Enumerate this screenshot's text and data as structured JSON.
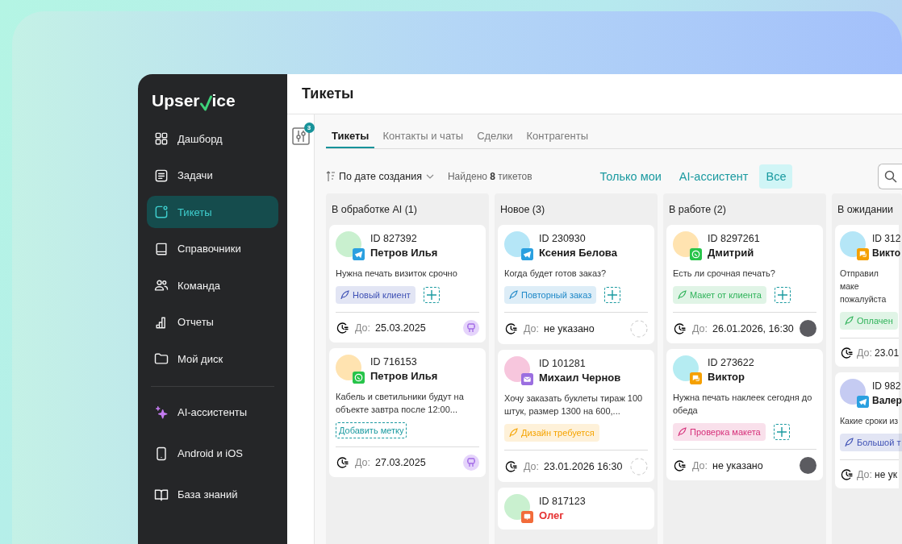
{
  "logo": {
    "before": "Upser",
    "after": "ice"
  },
  "sidebar": {
    "items": [
      {
        "kind": "dashboard",
        "label": "Дашборд",
        "selected": false
      },
      {
        "kind": "tasks",
        "label": "Задачи",
        "selected": false
      },
      {
        "kind": "tickets",
        "label": "Тикеты",
        "selected": true
      },
      {
        "kind": "book",
        "label": "Справочники",
        "selected": false
      },
      {
        "kind": "team",
        "label": "Команда",
        "selected": false
      },
      {
        "kind": "reports",
        "label": "Отчеты",
        "selected": false
      },
      {
        "kind": "folder",
        "label": "Мой диск",
        "selected": false
      }
    ],
    "extra_items": [
      {
        "kind": "sparkle",
        "label": "AI-ассистенты",
        "selected": false
      },
      {
        "kind": "phone",
        "label": "Android и iOS",
        "selected": false
      },
      {
        "kind": "open-book",
        "label": "База знаний",
        "selected": false
      }
    ]
  },
  "header": {
    "title": "Тикеты"
  },
  "filter_badge": "3",
  "tabs": [
    {
      "label": "Тикеты",
      "selected": true
    },
    {
      "label": "Контакты и чаты",
      "selected": false
    },
    {
      "label": "Сделки",
      "selected": false
    },
    {
      "label": "Контрагенты",
      "selected": false
    }
  ],
  "toolbar": {
    "sort": "По дате создания",
    "found": "Найдено **8** тикетов",
    "filters": [
      {
        "label": "Только мои",
        "selected": false
      },
      {
        "label": "AI-ассистент",
        "selected": false
      },
      {
        "label": "Все",
        "selected": true
      }
    ]
  },
  "columns": [
    {
      "title": "В обработке AI (1)",
      "cards": [
        {
          "id": "ID 827392",
          "name": "Петров Илья",
          "name_alert": false,
          "avatar": {
            "color": "#c9f0cf"
          },
          "channel": {
            "kind": "telegram"
          },
          "message": "Нужна печать визиток срочно",
          "tag": {
            "label": "Новый клиент",
            "color": "#3f51b5"
          },
          "add_button": {
            "kind": "icon"
          },
          "due_prefix": "До:",
          "due": "25.03.2025",
          "assignee": {
            "kind": "bot"
          }
        },
        {
          "id": "ID 716153",
          "name": "Петров Илья",
          "name_alert": false,
          "avatar": {
            "color": "#ffe3b0"
          },
          "channel": {
            "kind": "whatsapp"
          },
          "message": "Кабель и светильники будут на объекте завтра после 12:00...",
          "add_button": {
            "kind": "text",
            "label": "Добавить метку"
          },
          "due_prefix": "До:",
          "due": "27.03.2025",
          "assignee": {
            "kind": "bot"
          }
        }
      ]
    },
    {
      "title": "Новое (3)",
      "cards": [
        {
          "id": "ID 230930",
          "name": "Ксения Белова",
          "name_alert": false,
          "avatar": {
            "color": "#b5e6f7"
          },
          "channel": {
            "kind": "telegram"
          },
          "message": "Когда будет готов заказ?",
          "tag": {
            "label": "Повторный заказ",
            "color": "#1e88c8"
          },
          "add_button": {
            "kind": "icon"
          },
          "due_prefix": "До:",
          "due": "не указано",
          "assignee": {
            "kind": "empty"
          }
        },
        {
          "id": "ID 101281",
          "name": "Михаил Чернов",
          "name_alert": false,
          "avatar": {
            "color": "#f7c6dd"
          },
          "channel": {
            "kind": "email"
          },
          "message": "Хочу заказать буклеты тираж 100 штук, размер 1300 на 600,...",
          "tag": {
            "label": "Дизайн требуется",
            "color": "#f5a300"
          },
          "due_prefix": "До:",
          "due": "23.01.2026 16:30",
          "assignee": {
            "kind": "empty"
          }
        },
        {
          "id": "ID 817123",
          "name": "Олег",
          "name_alert": true,
          "avatar": {
            "color": "#c9f0cf"
          },
          "channel": {
            "kind": "chat-red"
          }
        }
      ]
    },
    {
      "title": "В работе (2)",
      "cards": [
        {
          "id": "ID 8297261",
          "name": "Дмитрий",
          "name_alert": false,
          "avatar": {
            "color": "#ffe3b0"
          },
          "channel": {
            "kind": "whatsapp"
          },
          "message": "Есть ли срочная печать?",
          "tag": {
            "label": "Макет от клиента",
            "color": "#2fb35a"
          },
          "add_button": {
            "kind": "icon"
          },
          "due_prefix": "До:",
          "due": "26.01.2026, 16:30",
          "assignee": {
            "kind": "photo"
          }
        },
        {
          "id": "ID 273622",
          "name": "Виктор",
          "name_alert": false,
          "avatar": {
            "color": "#b5ecf2"
          },
          "channel": {
            "kind": "chat"
          },
          "message": "Нужна печать наклеек сегодня до обеда",
          "tag": {
            "label": "Проверка макета",
            "color": "#d6307a"
          },
          "add_button": {
            "kind": "icon"
          },
          "due_prefix": "До:",
          "due": "не указано",
          "assignee": {
            "kind": "photo"
          }
        }
      ]
    },
    {
      "title": "В ожидании",
      "cards": [
        {
          "id": "ID 312",
          "name": "Викто",
          "name_alert": false,
          "avatar": {
            "color": "#b5e6f7"
          },
          "channel": {
            "kind": "chat"
          },
          "message": "Отправил маке пожалуйста",
          "tag": {
            "label": "Оплачен",
            "color": "#2fb35a"
          },
          "due_prefix": "До:",
          "due": "23.01"
        },
        {
          "id": "ID 982",
          "name": "Валер",
          "name_alert": false,
          "avatar": {
            "color": "#c5cbf2"
          },
          "channel": {
            "kind": "telegram"
          },
          "message": "Какие сроки из",
          "tag": {
            "label": "Большой т",
            "color": "#3f51b5"
          },
          "due_prefix": "До:",
          "due": "не ук"
        }
      ]
    }
  ]
}
